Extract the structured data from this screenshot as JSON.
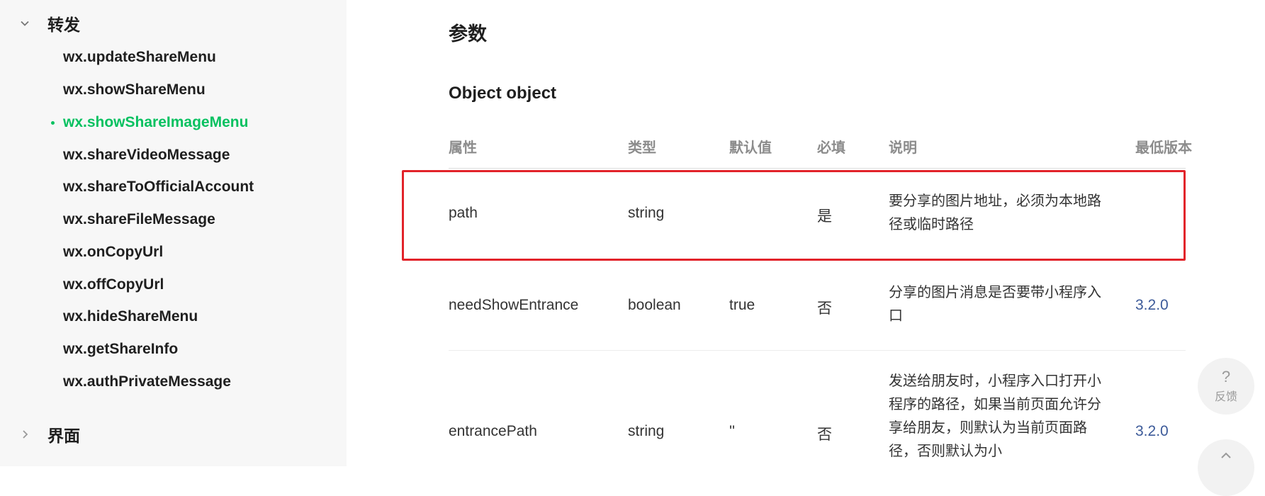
{
  "sidebar": {
    "group_open": {
      "label": "转发",
      "icon": "chevron-down-icon"
    },
    "items": [
      {
        "label": "wx.updateShareMenu"
      },
      {
        "label": "wx.showShareMenu"
      },
      {
        "label": "wx.showShareImageMenu",
        "active": true
      },
      {
        "label": "wx.shareVideoMessage"
      },
      {
        "label": "wx.shareToOfficialAccount"
      },
      {
        "label": "wx.shareFileMessage"
      },
      {
        "label": "wx.onCopyUrl"
      },
      {
        "label": "wx.offCopyUrl"
      },
      {
        "label": "wx.hideShareMenu"
      },
      {
        "label": "wx.getShareInfo"
      },
      {
        "label": "wx.authPrivateMessage"
      }
    ],
    "group_closed": {
      "label": "界面",
      "icon": "chevron-right-icon"
    },
    "active_color": "#07c160"
  },
  "main": {
    "section_title": "参数",
    "object_title": "Object object",
    "table": {
      "headers": [
        "属性",
        "类型",
        "默认值",
        "必填",
        "说明",
        "最低版本"
      ],
      "rows": [
        {
          "name": "path",
          "type": "string",
          "default": "",
          "required": "是",
          "desc": "要分享的图片地址，必须为本地路径或临时路径",
          "version": ""
        },
        {
          "name": "needShowEntrance",
          "type": "boolean",
          "default": "true",
          "required": "否",
          "desc": "分享的图片消息是否要带小程序入口",
          "version": "3.2.0"
        },
        {
          "name": "entrancePath",
          "type": "string",
          "default": "''",
          "required": "否",
          "desc": "发送给朋友时，小程序入口打开小程序的路径，如果当前页面允许分享给朋友，则默认为当前页面路径，否则默认为小",
          "version": "3.2.0"
        }
      ]
    },
    "highlight_color": "#e2232a"
  },
  "feedback": {
    "symbol": "?",
    "label": "反馈"
  },
  "scroll_top": {
    "icon": "arrow-up-icon"
  }
}
